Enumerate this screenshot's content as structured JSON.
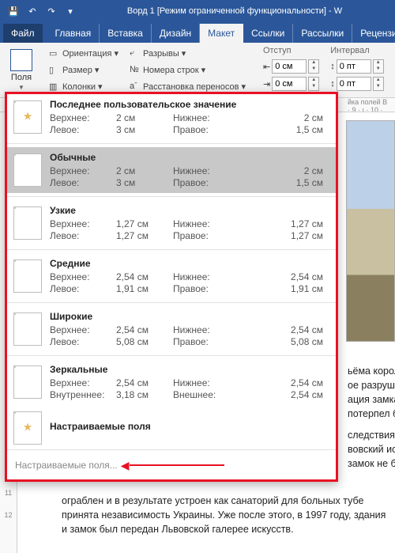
{
  "titlebar": {
    "title": "Ворд 1 [Режим ограниченной функциональности] - W"
  },
  "tabs": {
    "file": "Файл",
    "items": [
      "Главная",
      "Вставка",
      "Дизайн",
      "Макет",
      "Ссылки",
      "Рассылки",
      "Рецензи"
    ],
    "active": "Макет"
  },
  "ribbon": {
    "margins_label": "Поля",
    "orientation": "Ориентация",
    "size": "Размер",
    "columns": "Колонки",
    "breaks": "Разрывы",
    "line_numbers": "Номера строк",
    "hyphenation": "Расстановка переносов",
    "indent_label": "Отступ",
    "interval_label": "Интервал",
    "indent_left": "0 см",
    "indent_right": "0 см",
    "spacing_before": "0 пт",
    "spacing_after": "0 пт",
    "side_text": "йка полей В"
  },
  "margins_menu": {
    "items": [
      {
        "title": "Последнее пользовательское значение",
        "top_k": "Верхнее:",
        "top_v": "2 см",
        "left_k": "Левое:",
        "left_v": "3 см",
        "bottom_k": "Нижнее:",
        "bottom_v": "2 см",
        "right_k": "Правое:",
        "right_v": "1,5 см",
        "star": true,
        "sel": false
      },
      {
        "title": "Обычные",
        "top_k": "Верхнее:",
        "top_v": "2 см",
        "left_k": "Левое:",
        "left_v": "3 см",
        "bottom_k": "Нижнее:",
        "bottom_v": "2 см",
        "right_k": "Правое:",
        "right_v": "1,5 см",
        "star": false,
        "sel": true
      },
      {
        "title": "Узкие",
        "top_k": "Верхнее:",
        "top_v": "1,27 см",
        "left_k": "Левое:",
        "left_v": "1,27 см",
        "bottom_k": "Нижнее:",
        "bottom_v": "1,27 см",
        "right_k": "Правое:",
        "right_v": "1,27 см",
        "star": false,
        "sel": false
      },
      {
        "title": "Средние",
        "top_k": "Верхнее:",
        "top_v": "2,54 см",
        "left_k": "Левое:",
        "left_v": "1,91 см",
        "bottom_k": "Нижнее:",
        "bottom_v": "2,54 см",
        "right_k": "Правое:",
        "right_v": "1,91 см",
        "star": false,
        "sel": false
      },
      {
        "title": "Широкие",
        "top_k": "Верхнее:",
        "top_v": "2,54 см",
        "left_k": "Левое:",
        "left_v": "5,08 см",
        "bottom_k": "Нижнее:",
        "bottom_v": "2,54 см",
        "right_k": "Правое:",
        "right_v": "5,08 см",
        "star": false,
        "sel": false
      },
      {
        "title": "Зеркальные",
        "top_k": "Верхнее:",
        "top_v": "2,54 см",
        "left_k": "Внутреннее:",
        "left_v": "3,18 см",
        "bottom_k": "Нижнее:",
        "bottom_v": "2,54 см",
        "right_k": "Внешнее:",
        "right_v": "2,54 см",
        "star": false,
        "sel": false
      }
    ],
    "custom_title": "Настраиваемые поля",
    "custom_footer": "Настраиваемые поля..."
  },
  "doc": {
    "side_lines": [
      "ьёма короля",
      "ое разрушен",
      "ация замка,",
      "потерпел бе",
      "следствия, вы",
      "вовский исто",
      "замок не был"
    ],
    "body": "ограблен и в результате устроен как санаторий для больных тубе принята независимость Украины. Уже после этого, в 1997 году, здания и замок был передан Львовской галерее искусств."
  }
}
